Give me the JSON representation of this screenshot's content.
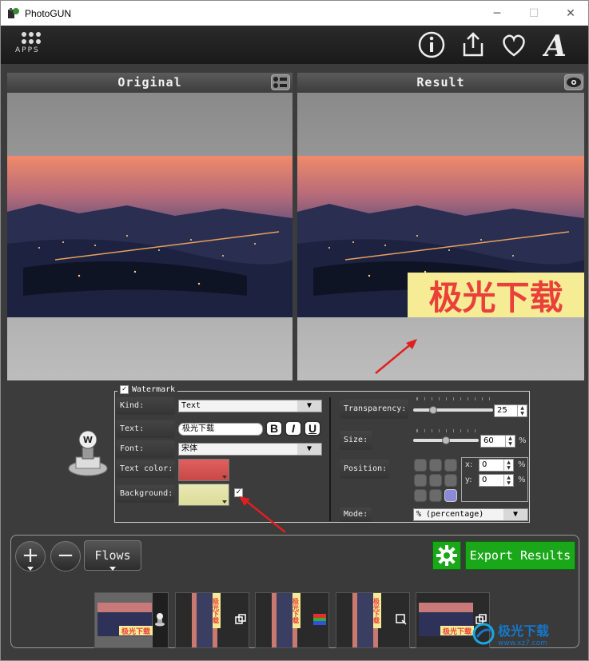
{
  "window": {
    "title": "PhotoGUN",
    "minimize": "─",
    "maximize": "☐",
    "close": "✕"
  },
  "toolbar": {
    "apps_label": "APPS"
  },
  "panels": {
    "original_title": "Original",
    "result_title": "Result"
  },
  "watermark_text_rendered": "极光下载",
  "watermark": {
    "section_title": "Watermark",
    "enabled": true,
    "kind_label": "Kind:",
    "kind_value": "Text",
    "text_label": "Text:",
    "text_value": "极光下载",
    "bold_label": "B",
    "italic_label": "I",
    "underline_label": "U",
    "font_label": "Font:",
    "font_value": "宋体",
    "text_color_label": "Text color:",
    "text_color": "#e06060",
    "background_label": "Background:",
    "background_color": "#dcdc9a",
    "background_enabled": true,
    "transparency_label": "Transparency:",
    "transparency_value": "25",
    "transparency_level": 0.25,
    "size_label": "Size:",
    "size_value": "60",
    "size_level": 0.5,
    "percent_sign": "%",
    "position_label": "Position:",
    "x_label": "x:",
    "x_value": "0",
    "y_label": "y:",
    "y_value": "0",
    "mode_label": "Mode:",
    "mode_value": "% (percentage)"
  },
  "bottom": {
    "add_label": "+",
    "remove_label": "−",
    "flows_label": "Flows",
    "export_label": "Export Results"
  },
  "thumbnails": {
    "wm_text": "极光下载"
  },
  "site_logo": {
    "name": "极光下载",
    "url": "www.xz7.com"
  },
  "colors": {
    "export_green": "#1aa81a",
    "watermark_bg": "#f6ec96",
    "watermark_fg": "#e9403a"
  }
}
